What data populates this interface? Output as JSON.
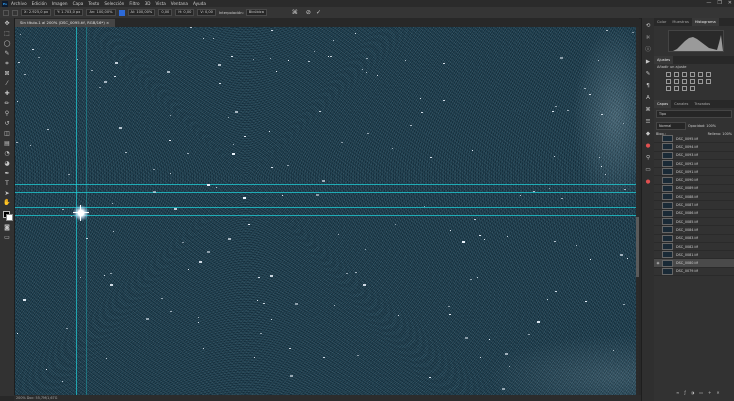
{
  "menu": {
    "logo": "Ps",
    "items": [
      "Archivo",
      "Edición",
      "Imagen",
      "Capa",
      "Texto",
      "Selección",
      "Filtro",
      "3D",
      "Vista",
      "Ventana",
      "Ayuda"
    ]
  },
  "window_controls": [
    "—",
    "❐",
    "✕"
  ],
  "options_bar": {
    "fields": [
      "X: 2.925,0 px",
      "Y: 1.703,0 px",
      "An: 100,00%",
      "Al: 100,00%",
      "0,00",
      "H: 0,00",
      "V: 0,00"
    ],
    "interp_label": "Interpolación:",
    "interp_value": "Bicúbica",
    "cancel": "⊘",
    "commit": "✓"
  },
  "document_tab": "Sin título-1 al 200% (DSC_0095.tif, RGB/16*) ×",
  "status_text": "200%    Doc: 55,7M/1,67G",
  "panels": {
    "top_tabs": [
      "Color",
      "Muestras",
      "Histograma"
    ],
    "top_active": 2,
    "adjust_tab": "Ajustes",
    "adjust_subtitle": "Añadir un ajuste",
    "layer_tabs": [
      "Capas",
      "Canales",
      "Trazados"
    ],
    "layer_active": 0,
    "kind_filter": "Tipo",
    "blend_mode": "Normal",
    "opacity": "Opacidad: 100%",
    "fill": "Relleno: 100%",
    "lock": "Bloq.:",
    "layers": [
      {
        "name": "DSC_0095.tif",
        "sel": false
      },
      {
        "name": "DSC_0094.tif",
        "sel": false
      },
      {
        "name": "DSC_0093.tif",
        "sel": false
      },
      {
        "name": "DSC_0092.tif",
        "sel": false
      },
      {
        "name": "DSC_0091.tif",
        "sel": false
      },
      {
        "name": "DSC_0090.tif",
        "sel": false
      },
      {
        "name": "DSC_0089.tif",
        "sel": false
      },
      {
        "name": "DSC_0088.tif",
        "sel": false
      },
      {
        "name": "DSC_0087.tif",
        "sel": false
      },
      {
        "name": "DSC_0086.tif",
        "sel": false
      },
      {
        "name": "DSC_0085.tif",
        "sel": false
      },
      {
        "name": "DSC_0084.tif",
        "sel": false
      },
      {
        "name": "DSC_0083.tif",
        "sel": false
      },
      {
        "name": "DSC_0082.tif",
        "sel": false
      },
      {
        "name": "DSC_0081.tif",
        "sel": false
      },
      {
        "name": "DSC_0080.tif",
        "sel": true
      },
      {
        "name": "DSC_0079.tif",
        "sel": false
      }
    ]
  },
  "colors": {
    "guide": "#1fd0d8",
    "accent": "#2d6ad8"
  }
}
